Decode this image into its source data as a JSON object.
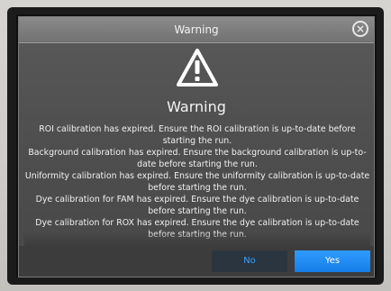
{
  "dialog": {
    "title": "Warning",
    "heading": "Warning",
    "close_glyph": "×",
    "messages": [
      "ROI calibration has expired. Ensure the ROI calibration is up-to-date before starting the run.",
      "Background calibration has expired. Ensure the background calibration is up-to-date before starting the run.",
      "Uniformity calibration has expired. Ensure the uniformity calibration is up-to-date before starting the run.",
      "Dye calibration for FAM has expired. Ensure the dye calibration is up-to-date before starting the run.",
      "Dye calibration for ROX has expired. Ensure the dye calibration is up-to-date before starting the run."
    ],
    "buttons": {
      "no_label": "No",
      "yes_label": "Yes"
    }
  },
  "icons": {
    "warning": "warning-triangle-icon",
    "close": "close-circle-icon"
  },
  "colors": {
    "dialog_bg": "#505050",
    "titlebar_bg": "#7c7c7c",
    "primary_button": "#1f8cf2",
    "secondary_button_text": "#3aa0ff"
  }
}
